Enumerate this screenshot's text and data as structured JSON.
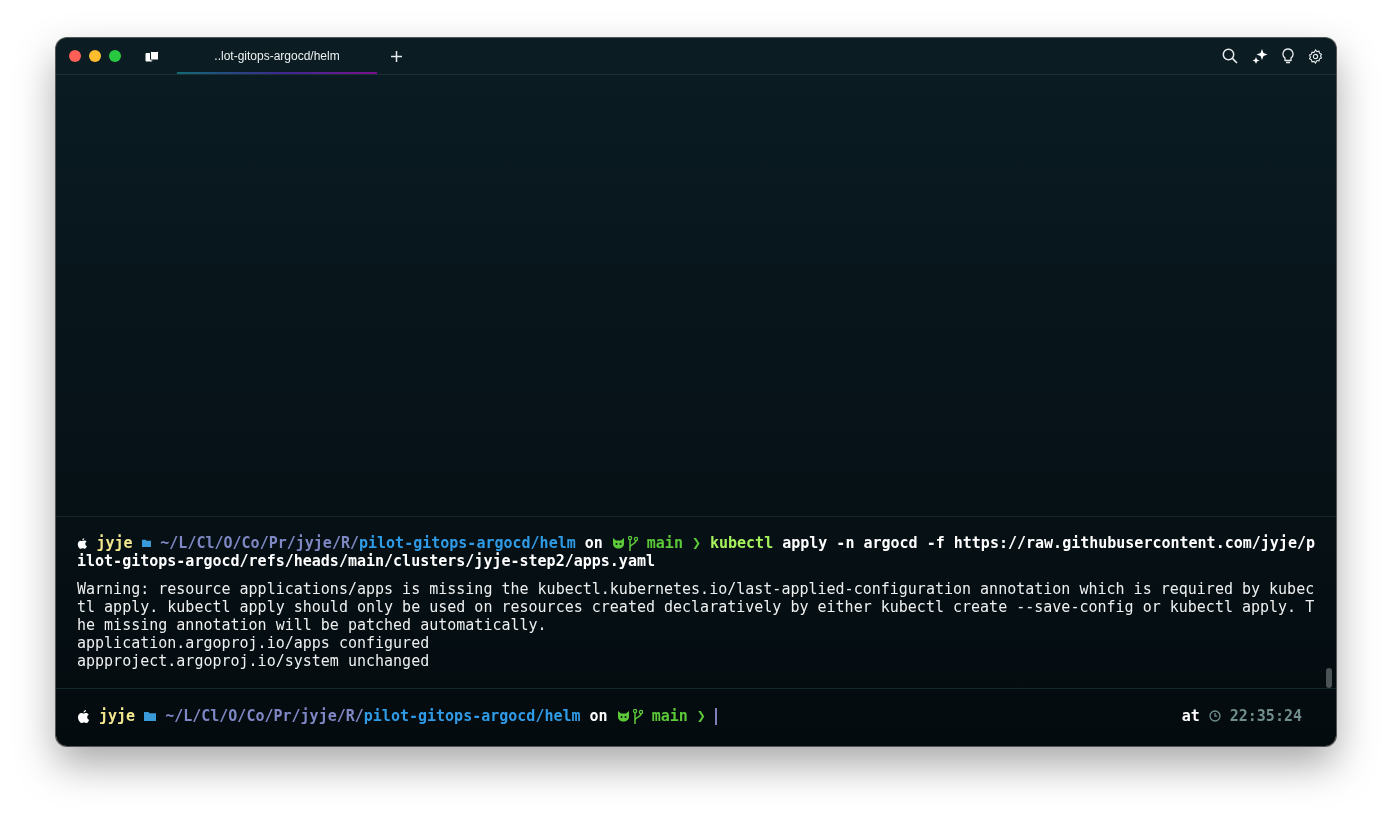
{
  "tabs": [
    {
      "label": "..lot-gitops-argocd/helm",
      "selected": true
    }
  ],
  "blocks": [
    {
      "prompt": {
        "user": "jyje",
        "path_prefix": "~/L/Cl/O/Co/Pr/jyje/R/",
        "path_current": "pilot-gitops-argocd/helm",
        "on": "on",
        "branch": "main",
        "symbol": "❯"
      },
      "command": {
        "program": "kubectl",
        "args": "apply -n argocd -f https://raw.githubusercontent.com/jyje/p",
        "continuation": "ilot-gitops-argocd/refs/heads/main/clusters/jyje-step2/apps.yaml"
      },
      "output": [
        "Warning: resource applications/apps is missing the kubectl.kubernetes.io/last-applied-configuration annotation which is required by kubec",
        "tl apply. kubectl apply should only be used on resources created declaratively by either kubectl create --save-config or kubectl apply. T",
        "he missing annotation will be patched automatically.",
        "application.argoproj.io/apps configured",
        "appproject.argoproj.io/system unchanged"
      ]
    }
  ],
  "input_prompt": {
    "prompt": {
      "user": "jyje",
      "path_prefix": "~/L/Cl/O/Co/Pr/jyje/R/",
      "path_current": "pilot-gitops-argocd/helm",
      "on": "on",
      "branch": "main",
      "symbol": "❯"
    },
    "right_label": "at",
    "time": "22:35:24"
  }
}
